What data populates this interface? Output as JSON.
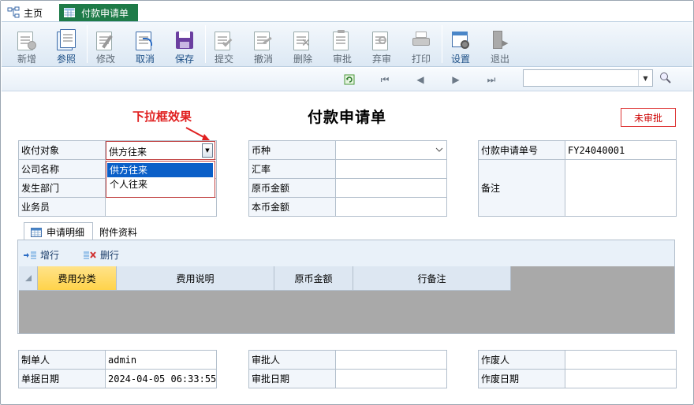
{
  "tabs": {
    "home": "主页",
    "active": "付款申请单"
  },
  "toolbar": {
    "new": "新增",
    "ref": "参照",
    "edit": "修改",
    "cancel": "取消",
    "save": "保存",
    "submit": "提交",
    "revoke": "撤消",
    "delete": "删除",
    "approve": "审批",
    "abandon": "弃审",
    "print": "打印",
    "settings": "设置",
    "exit": "退出"
  },
  "search": {
    "value": ""
  },
  "page": {
    "title": "付款申请单",
    "status": "未审批",
    "annotation": "下拉框效果"
  },
  "header_form": {
    "payee_type_label": "收付对象",
    "payee_type_value": "供方往来",
    "company_label": "公司名称",
    "dept_label": "发生部门",
    "salesman_label": "业务员",
    "currency_label": "币种",
    "rate_label": "汇率",
    "orig_amount_label": "原币金额",
    "local_amount_label": "本币金额",
    "docno_label": "付款申请单号",
    "docno_value": "FY24040001",
    "remark_label": "备注"
  },
  "dropdown": {
    "options": [
      "供方往来",
      "个人往来"
    ]
  },
  "subtabs": {
    "detail": "申请明细",
    "attachments": "附件资料"
  },
  "grid": {
    "add_row": "增行",
    "delete_row": "删行",
    "columns": [
      "费用分类",
      "费用说明",
      "原币金额",
      "行备注"
    ]
  },
  "footer_form": {
    "creator_label": "制单人",
    "creator_value": "admin",
    "date_label": "单据日期",
    "date_value": "2024-04-05 06:33:55",
    "approver_label": "审批人",
    "approve_date_label": "审批日期",
    "voider_label": "作废人",
    "void_date_label": "作废日期"
  },
  "colors": {
    "accent_green": "#1e7b48",
    "status_red": "#cc0000",
    "highlight_header": "#ffd34a",
    "selected_option": "#0a5fc8"
  }
}
